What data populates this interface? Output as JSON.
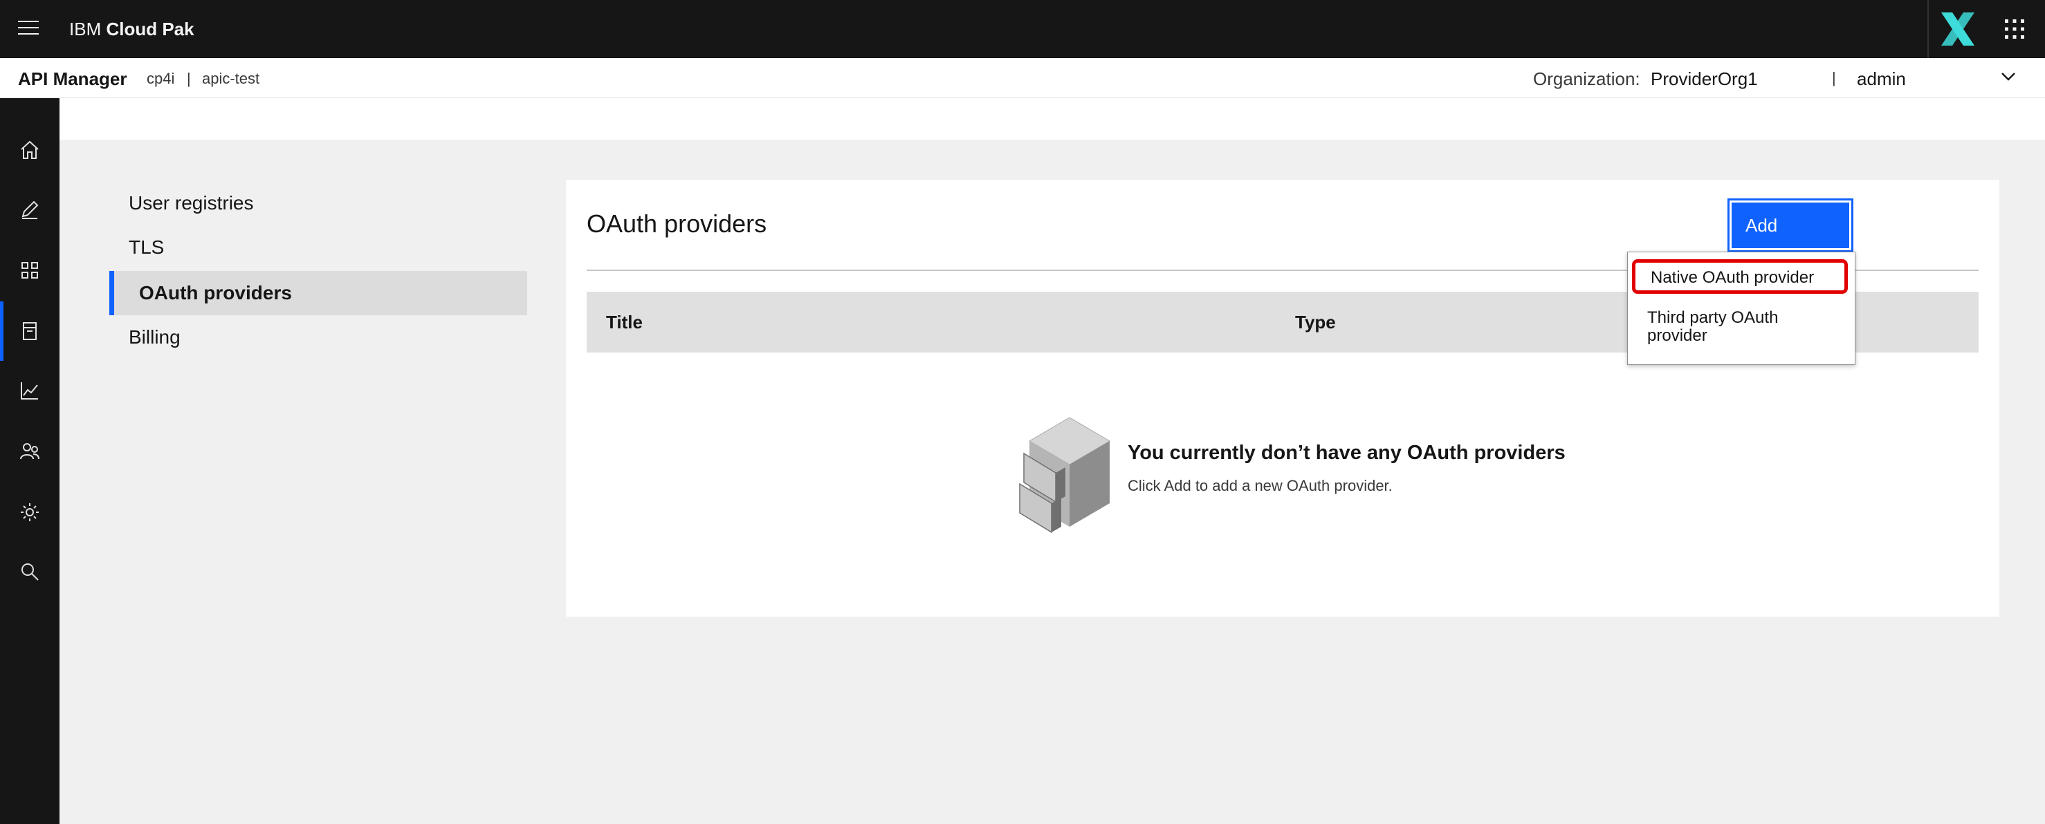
{
  "header": {
    "brand_prefix": "IBM",
    "brand_name": "Cloud Pak",
    "menu_icon": "hamburger-menu-icon",
    "logo_icon": "cloud-pak-logo-icon",
    "switcher_icon": "app-switcher-icon"
  },
  "subheader": {
    "app_name": "API Manager",
    "crumb_1": "cp4i",
    "separator": "|",
    "crumb_2": "apic-test",
    "org_label": "Organization:",
    "org_value": "ProviderOrg1",
    "user_separator": "|",
    "user": "admin"
  },
  "rail": {
    "items": [
      {
        "icon": "home-icon"
      },
      {
        "icon": "edit-icon"
      },
      {
        "icon": "apps-grid-icon"
      },
      {
        "icon": "resources-icon",
        "active": true
      },
      {
        "icon": "analytics-icon"
      },
      {
        "icon": "members-icon"
      },
      {
        "icon": "settings-icon"
      },
      {
        "icon": "search-icon"
      }
    ]
  },
  "subnav": {
    "items": [
      {
        "label": "User registries"
      },
      {
        "label": "TLS"
      },
      {
        "label": "OAuth providers",
        "active": true
      },
      {
        "label": "Billing"
      }
    ]
  },
  "main": {
    "title": "OAuth providers",
    "add_button": "Add",
    "columns": [
      "Title",
      "Type"
    ],
    "empty_title": "You currently don’t have any OAuth providers",
    "empty_text": "Click Add to add a new OAuth provider.",
    "empty_icon": "file-cabinet-icon"
  },
  "add_menu": {
    "items": [
      {
        "label": "Native OAuth provider",
        "highlighted": true
      },
      {
        "label": "Third party OAuth provider"
      }
    ]
  },
  "colors": {
    "accent": "#0f62fe",
    "highlight": "#e10000",
    "header_bg": "#161616"
  }
}
